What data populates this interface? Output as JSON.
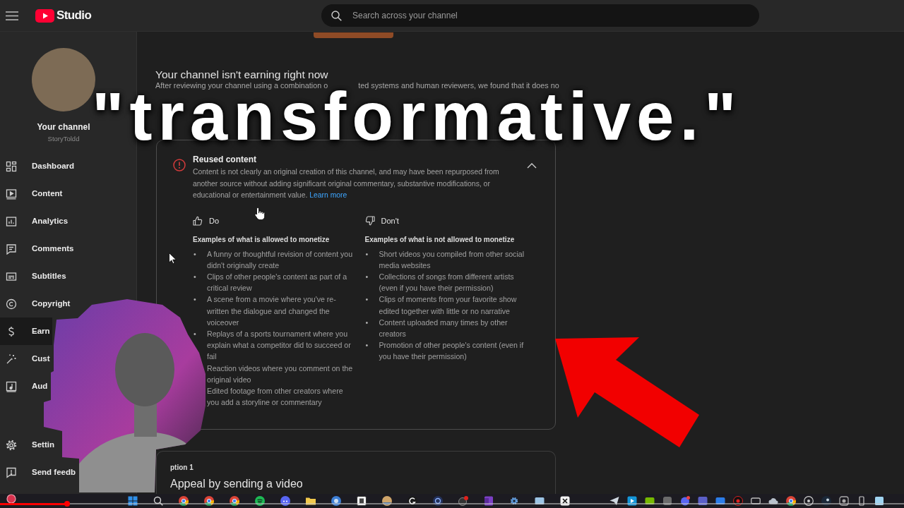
{
  "header": {
    "logo_text": "Studio",
    "search": {
      "placeholder": "Search across your channel"
    }
  },
  "sidebar": {
    "channel_title": "Your channel",
    "channel_handle": "StoryToldd",
    "items": [
      {
        "label": "Dashboard",
        "selected": false
      },
      {
        "label": "Content",
        "selected": false
      },
      {
        "label": "Analytics",
        "selected": false
      },
      {
        "label": "Comments",
        "selected": false
      },
      {
        "label": "Subtitles",
        "selected": false
      },
      {
        "label": "Copyright",
        "selected": false
      },
      {
        "label": "Earn",
        "selected": true
      },
      {
        "label": "Cust",
        "selected": false
      },
      {
        "label": "Aud",
        "selected": false
      }
    ],
    "footer_items": [
      {
        "label": "Settin",
        "selected": false
      },
      {
        "label": "Send feedb",
        "selected": false
      }
    ]
  },
  "main": {
    "title": "Your channel isn't earning right now",
    "message_fragments": [
      "After reviewing your channel using a combination o",
      "ted systems and human reviewers, we found that it does no"
    ],
    "policy_card": {
      "title": "Reused content",
      "description": "Content is not clearly an original creation of this channel, and may have been repurposed from another source without adding significant original commentary, substantive modifications, or educational or entertainment value.",
      "link": "Learn more",
      "expanded": true,
      "columns": [
        {
          "kind": "do",
          "label": "Do",
          "heading": "Examples of what is allowed to monetize",
          "examples": [
            {
              "bullet": "•",
              "text": "A funny or thoughtful revision of content you didn't originally create"
            },
            {
              "bullet": "•",
              "text": "Clips of other people's content as part of a critical review"
            },
            {
              "bullet": "•",
              "text": "A scene from a movie where you've re-written the dialogue and changed the voiceover"
            },
            {
              "bullet": "•",
              "text": "Replays of a sports tournament where you explain what a competitor did to succeed or fail"
            },
            {
              "text": "Reaction videos where you comment on the original video"
            },
            {
              "text": "Edited footage from other creators where you add a storyline or commentary"
            }
          ]
        },
        {
          "kind": "dont",
          "label": "Don't",
          "heading": "Examples of what is not allowed to monetize",
          "examples": [
            {
              "bullet": "•",
              "text": "Short videos you compiled from other social media websites"
            },
            {
              "bullet": "•",
              "text": "Collections of songs from different artists (even if you have their permission)"
            },
            {
              "bullet": "•",
              "text": "Clips of moments from your favorite show edited together with little or no narrative"
            },
            {
              "bullet": "•",
              "text": "Content uploaded many times by other creators"
            },
            {
              "bullet": "•",
              "text": "Promotion of other people's content (even if you have their permission)"
            }
          ]
        }
      ]
    },
    "option_card": {
      "label": "ption 1",
      "title": "Appeal by sending a video"
    }
  },
  "caption_overlay": "\"transformative.\"",
  "video_progress": {
    "level": 0.074
  }
}
